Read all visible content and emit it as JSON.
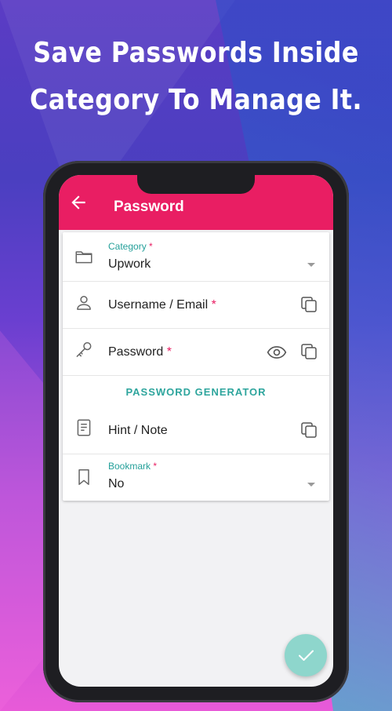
{
  "headline": {
    "line1": "Save Passwords Inside",
    "line2": "Category To Manage It."
  },
  "appbar": {
    "title": "Password",
    "back_icon": "arrow-left-icon",
    "color": "#e91e63"
  },
  "form": {
    "category": {
      "label": "Category",
      "required_mark": "*",
      "value": "Upwork",
      "icon": "folder-icon"
    },
    "username": {
      "label": "Username / Email",
      "required_mark": "*",
      "icon": "person-icon"
    },
    "password": {
      "label": "Password",
      "required_mark": "*",
      "icon": "key-icon"
    },
    "generator_button": "PASSWORD GENERATOR",
    "hint": {
      "label": "Hint / Note",
      "icon": "note-icon"
    },
    "bookmark": {
      "label": "Bookmark",
      "required_mark": "*",
      "value": "No",
      "icon": "bookmark-icon"
    }
  },
  "accent_color": "#2ea59d",
  "fab": {
    "icon": "check-icon",
    "color": "#8ed6cc"
  }
}
